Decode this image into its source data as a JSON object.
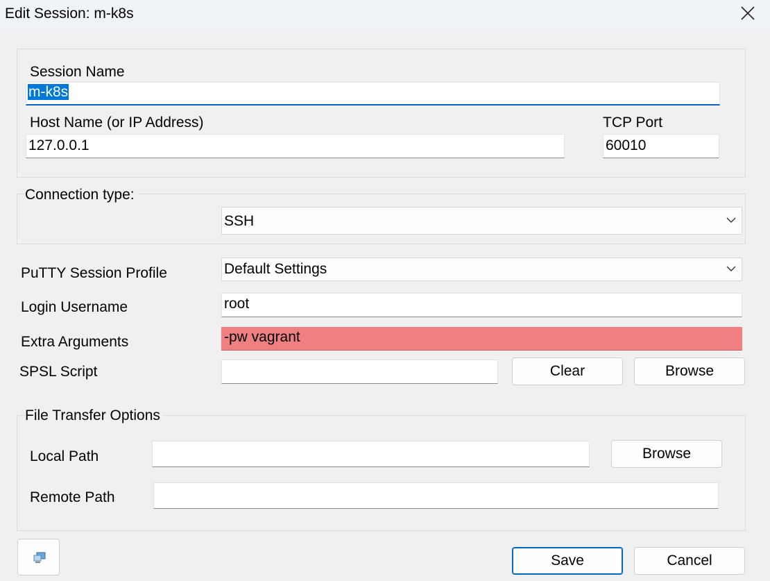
{
  "window": {
    "title": "Edit Session: m-k8s"
  },
  "session": {
    "name_label": "Session Name",
    "name_value": "m-k8s",
    "host_label": "Host Name (or IP Address)",
    "host_value": "127.0.0.1",
    "port_label": "TCP Port",
    "port_value": "60010"
  },
  "connection": {
    "label": "Connection type:",
    "value": "SSH"
  },
  "settings": {
    "profile_label": "PuTTY Session Profile",
    "profile_value": "Default Settings",
    "username_label": "Login Username",
    "username_value": "root",
    "extra_label": "Extra Arguments",
    "extra_value": "-pw vagrant",
    "spsl_label": "SPSL Script",
    "spsl_value": "",
    "clear_label": "Clear",
    "browse_label": "Browse"
  },
  "file_transfer": {
    "group_label": "File Transfer Options",
    "local_label": "Local Path",
    "local_value": "",
    "local_browse_label": "Browse",
    "remote_label": "Remote Path",
    "remote_value": ""
  },
  "footer": {
    "icon": "computer-icon",
    "save_label": "Save",
    "cancel_label": "Cancel"
  },
  "colors": {
    "accent": "#0067c0",
    "selection": "#0078d7",
    "highlight_field": "#f08080"
  }
}
